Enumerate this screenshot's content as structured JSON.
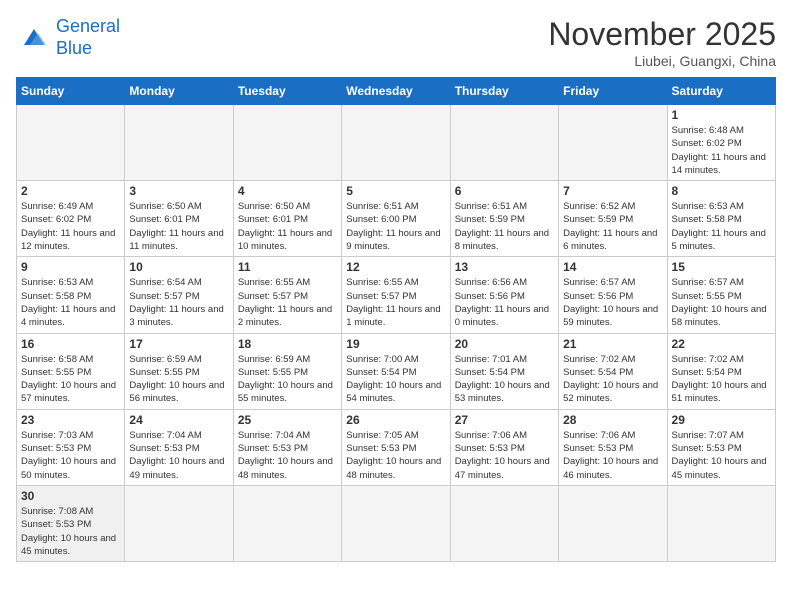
{
  "logo": {
    "line1": "General",
    "line2": "Blue"
  },
  "title": "November 2025",
  "location": "Liubei, Guangxi, China",
  "days_of_week": [
    "Sunday",
    "Monday",
    "Tuesday",
    "Wednesday",
    "Thursday",
    "Friday",
    "Saturday"
  ],
  "weeks": [
    [
      {
        "day": "",
        "info": ""
      },
      {
        "day": "",
        "info": ""
      },
      {
        "day": "",
        "info": ""
      },
      {
        "day": "",
        "info": ""
      },
      {
        "day": "",
        "info": ""
      },
      {
        "day": "",
        "info": ""
      },
      {
        "day": "1",
        "info": "Sunrise: 6:48 AM\nSunset: 6:02 PM\nDaylight: 11 hours and 14 minutes."
      }
    ],
    [
      {
        "day": "2",
        "info": "Sunrise: 6:49 AM\nSunset: 6:02 PM\nDaylight: 11 hours and 12 minutes."
      },
      {
        "day": "3",
        "info": "Sunrise: 6:50 AM\nSunset: 6:01 PM\nDaylight: 11 hours and 11 minutes."
      },
      {
        "day": "4",
        "info": "Sunrise: 6:50 AM\nSunset: 6:01 PM\nDaylight: 11 hours and 10 minutes."
      },
      {
        "day": "5",
        "info": "Sunrise: 6:51 AM\nSunset: 6:00 PM\nDaylight: 11 hours and 9 minutes."
      },
      {
        "day": "6",
        "info": "Sunrise: 6:51 AM\nSunset: 5:59 PM\nDaylight: 11 hours and 8 minutes."
      },
      {
        "day": "7",
        "info": "Sunrise: 6:52 AM\nSunset: 5:59 PM\nDaylight: 11 hours and 6 minutes."
      },
      {
        "day": "8",
        "info": "Sunrise: 6:53 AM\nSunset: 5:58 PM\nDaylight: 11 hours and 5 minutes."
      }
    ],
    [
      {
        "day": "9",
        "info": "Sunrise: 6:53 AM\nSunset: 5:58 PM\nDaylight: 11 hours and 4 minutes."
      },
      {
        "day": "10",
        "info": "Sunrise: 6:54 AM\nSunset: 5:57 PM\nDaylight: 11 hours and 3 minutes."
      },
      {
        "day": "11",
        "info": "Sunrise: 6:55 AM\nSunset: 5:57 PM\nDaylight: 11 hours and 2 minutes."
      },
      {
        "day": "12",
        "info": "Sunrise: 6:55 AM\nSunset: 5:57 PM\nDaylight: 11 hours and 1 minute."
      },
      {
        "day": "13",
        "info": "Sunrise: 6:56 AM\nSunset: 5:56 PM\nDaylight: 11 hours and 0 minutes."
      },
      {
        "day": "14",
        "info": "Sunrise: 6:57 AM\nSunset: 5:56 PM\nDaylight: 10 hours and 59 minutes."
      },
      {
        "day": "15",
        "info": "Sunrise: 6:57 AM\nSunset: 5:55 PM\nDaylight: 10 hours and 58 minutes."
      }
    ],
    [
      {
        "day": "16",
        "info": "Sunrise: 6:58 AM\nSunset: 5:55 PM\nDaylight: 10 hours and 57 minutes."
      },
      {
        "day": "17",
        "info": "Sunrise: 6:59 AM\nSunset: 5:55 PM\nDaylight: 10 hours and 56 minutes."
      },
      {
        "day": "18",
        "info": "Sunrise: 6:59 AM\nSunset: 5:55 PM\nDaylight: 10 hours and 55 minutes."
      },
      {
        "day": "19",
        "info": "Sunrise: 7:00 AM\nSunset: 5:54 PM\nDaylight: 10 hours and 54 minutes."
      },
      {
        "day": "20",
        "info": "Sunrise: 7:01 AM\nSunset: 5:54 PM\nDaylight: 10 hours and 53 minutes."
      },
      {
        "day": "21",
        "info": "Sunrise: 7:02 AM\nSunset: 5:54 PM\nDaylight: 10 hours and 52 minutes."
      },
      {
        "day": "22",
        "info": "Sunrise: 7:02 AM\nSunset: 5:54 PM\nDaylight: 10 hours and 51 minutes."
      }
    ],
    [
      {
        "day": "23",
        "info": "Sunrise: 7:03 AM\nSunset: 5:53 PM\nDaylight: 10 hours and 50 minutes."
      },
      {
        "day": "24",
        "info": "Sunrise: 7:04 AM\nSunset: 5:53 PM\nDaylight: 10 hours and 49 minutes."
      },
      {
        "day": "25",
        "info": "Sunrise: 7:04 AM\nSunset: 5:53 PM\nDaylight: 10 hours and 48 minutes."
      },
      {
        "day": "26",
        "info": "Sunrise: 7:05 AM\nSunset: 5:53 PM\nDaylight: 10 hours and 48 minutes."
      },
      {
        "day": "27",
        "info": "Sunrise: 7:06 AM\nSunset: 5:53 PM\nDaylight: 10 hours and 47 minutes."
      },
      {
        "day": "28",
        "info": "Sunrise: 7:06 AM\nSunset: 5:53 PM\nDaylight: 10 hours and 46 minutes."
      },
      {
        "day": "29",
        "info": "Sunrise: 7:07 AM\nSunset: 5:53 PM\nDaylight: 10 hours and 45 minutes."
      }
    ],
    [
      {
        "day": "30",
        "info": "Sunrise: 7:08 AM\nSunset: 5:53 PM\nDaylight: 10 hours and 45 minutes."
      },
      {
        "day": "",
        "info": ""
      },
      {
        "day": "",
        "info": ""
      },
      {
        "day": "",
        "info": ""
      },
      {
        "day": "",
        "info": ""
      },
      {
        "day": "",
        "info": ""
      },
      {
        "day": "",
        "info": ""
      }
    ]
  ]
}
